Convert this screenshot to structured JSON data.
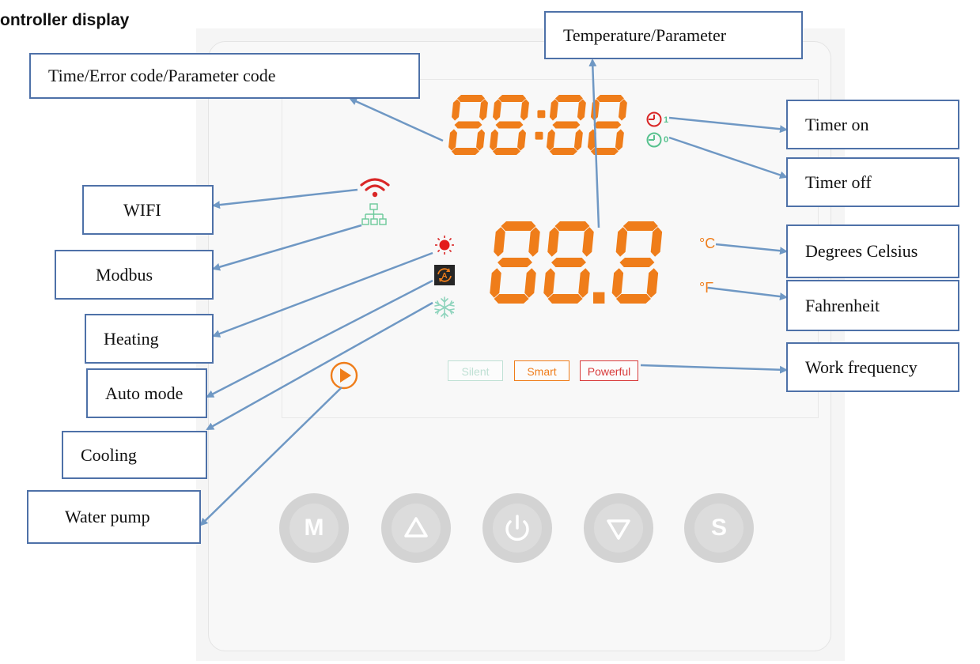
{
  "heading": "ontroller display",
  "display": {
    "time_digits": "88:88",
    "temp_digits": "88.8",
    "timer_on_index": "1",
    "timer_off_index": "0",
    "celsius": "°C",
    "fahrenheit": "°F"
  },
  "modes": [
    {
      "label": "Silent",
      "color": "#bfe0d4"
    },
    {
      "label": "Smart",
      "color": "#ef7d1a"
    },
    {
      "label": "Powerful",
      "color": "#d83a3a"
    }
  ],
  "buttons": [
    {
      "glyph": "M",
      "icon": "mode-button"
    },
    {
      "glyph": "",
      "icon": "up-triangle-icon"
    },
    {
      "glyph": "",
      "icon": "power-icon"
    },
    {
      "glyph": "",
      "icon": "down-triangle-icon"
    },
    {
      "glyph": "S",
      "icon": "set-button"
    }
  ],
  "labels": {
    "time_error": "Time/Error code/Parameter code",
    "temperature": "Temperature/Parameter",
    "timer_on": "Timer on",
    "timer_off": "Timer off",
    "wifi": "WIFI",
    "modbus": "Modbus",
    "celsius": "Degrees Celsius",
    "fahrenheit": "Fahrenheit",
    "heating": "Heating",
    "auto_mode": "Auto mode",
    "cooling": "Cooling",
    "work_frequency": "Work frequency",
    "water_pump": "Water pump"
  },
  "colors": {
    "segment": "#ef7d1a",
    "label_border": "#4e71a8",
    "arrow": "#6f98c4",
    "wifi": "#d92626",
    "modbus": "#6cc99a",
    "cooling": "#8fd4bd",
    "timer_on": "#d92626",
    "timer_off": "#58c28f"
  }
}
